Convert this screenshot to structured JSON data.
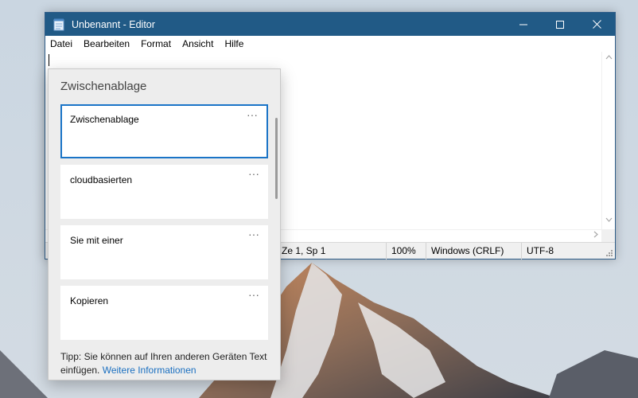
{
  "window": {
    "title": "Unbenannt - Editor",
    "minimize_glyph": "—",
    "maximize_glyph": "☐",
    "close_glyph": "✕"
  },
  "menu": {
    "items": [
      "Datei",
      "Bearbeiten",
      "Format",
      "Ansicht",
      "Hilfe"
    ]
  },
  "editor": {
    "content": ""
  },
  "statusbar": {
    "position": "Ze 1, Sp 1",
    "zoom": "100%",
    "line_ending": "Windows (CRLF)",
    "encoding": "UTF-8"
  },
  "clipboard": {
    "title": "Zwischenablage",
    "items": [
      {
        "text": "Zwischenablage",
        "more": "···"
      },
      {
        "text": "cloudbasierten",
        "more": "···"
      },
      {
        "text": "Sie mit einer",
        "more": "···"
      },
      {
        "text": "Kopieren",
        "more": "···"
      }
    ],
    "tip_text": "Tipp: Sie können auf Ihren anderen Geräten Text einfügen.",
    "link_text": "Weitere Informationen"
  },
  "colors": {
    "titlebar": "#215a86",
    "selection_border": "#1a74c7",
    "link": "#1a6fc0"
  },
  "icons": {
    "app": "notepad-icon",
    "scroll_up": "chevron-up-icon",
    "scroll_down": "chevron-down-icon",
    "scroll_right": "chevron-right-icon"
  }
}
